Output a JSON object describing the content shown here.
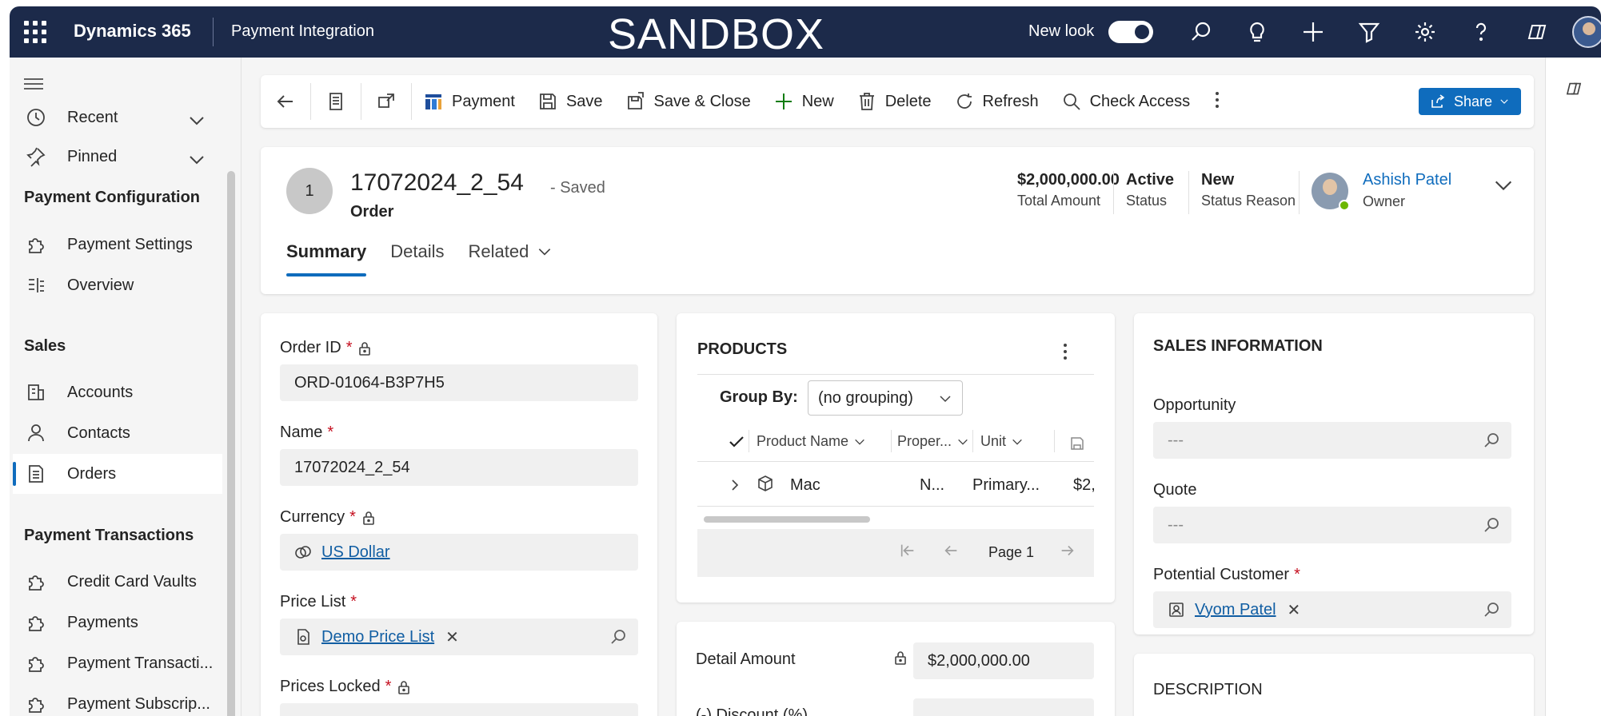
{
  "topbar": {
    "brand": "Dynamics 365",
    "app_name": "Payment Integration",
    "environment_banner": "SANDBOX",
    "new_look_label": "New look",
    "new_look_on": true,
    "icons": [
      "search-icon",
      "lightbulb-icon",
      "plus-icon",
      "filter-icon",
      "gear-icon",
      "help-icon",
      "copilot-icon",
      "user-avatar"
    ]
  },
  "sidebar": {
    "items_top": [
      {
        "label": "Recent",
        "icon": "clock-icon"
      },
      {
        "label": "Pinned",
        "icon": "pin-icon"
      }
    ],
    "groups": [
      {
        "title": "Payment Configuration",
        "items": [
          {
            "label": "Payment Settings",
            "icon": "puzzle-icon"
          },
          {
            "label": "Overview",
            "icon": "overview-icon"
          }
        ]
      },
      {
        "title": "Sales",
        "items": [
          {
            "label": "Accounts",
            "icon": "building-icon"
          },
          {
            "label": "Contacts",
            "icon": "person-icon"
          },
          {
            "label": "Orders",
            "icon": "document-icon",
            "active": true
          }
        ]
      },
      {
        "title": "Payment Transactions",
        "items": [
          {
            "label": "Credit Card Vaults",
            "icon": "puzzle-icon"
          },
          {
            "label": "Payments",
            "icon": "puzzle-icon"
          },
          {
            "label": "Payment Transacti...",
            "icon": "puzzle-icon"
          },
          {
            "label": "Payment Subscrip...",
            "icon": "puzzle-icon"
          }
        ]
      }
    ]
  },
  "commandbar": {
    "payment": "Payment",
    "save": "Save",
    "save_close": "Save & Close",
    "new": "New",
    "delete": "Delete",
    "refresh": "Refresh",
    "check_access": "Check Access",
    "share": "Share"
  },
  "record": {
    "avatar_initial": "1",
    "title": "17072024_2_54",
    "saved_state": "- Saved",
    "entity": "Order",
    "total_amount": {
      "value": "$2,000,000.00",
      "label": "Total Amount"
    },
    "status": {
      "value": "Active",
      "label": "Status"
    },
    "status_reason": {
      "value": "New",
      "label": "Status Reason"
    },
    "owner": {
      "name": "Ashish Patel",
      "label": "Owner"
    },
    "tabs": [
      "Summary",
      "Details",
      "Related"
    ]
  },
  "form": {
    "order_id": {
      "label": "Order ID",
      "value": "ORD-01064-B3P7H5"
    },
    "name": {
      "label": "Name",
      "value": "17072024_2_54"
    },
    "currency": {
      "label": "Currency",
      "value": "US Dollar"
    },
    "price_list": {
      "label": "Price List",
      "value": "Demo Price List"
    },
    "prices_locked": {
      "label": "Prices Locked"
    }
  },
  "products": {
    "title": "PRODUCTS",
    "group_by_label": "Group By:",
    "group_by_value": "(no grouping)",
    "columns": [
      "Product Name",
      "Proper...",
      "Unit"
    ],
    "rows": [
      {
        "name": "Mac",
        "property": "N...",
        "unit": "Primary...",
        "amount": "$2,"
      }
    ],
    "page_label": "Page 1"
  },
  "amounts": {
    "detail_amount_label": "Detail Amount",
    "detail_amount_value": "$2,000,000.00",
    "discount_label": "(-) Discount (%)",
    "discount_value": "---"
  },
  "sales_info": {
    "title": "SALES INFORMATION",
    "opportunity": {
      "label": "Opportunity",
      "value": "---"
    },
    "quote": {
      "label": "Quote",
      "value": "---"
    },
    "potential_customer": {
      "label": "Potential Customer",
      "value": "Vyom Patel"
    }
  },
  "description": {
    "title": "DESCRIPTION"
  },
  "colors": {
    "topbar": "#1c2a4a",
    "accent": "#0f6cbd",
    "required": "#c50f1f",
    "presence": "#6bb700"
  }
}
